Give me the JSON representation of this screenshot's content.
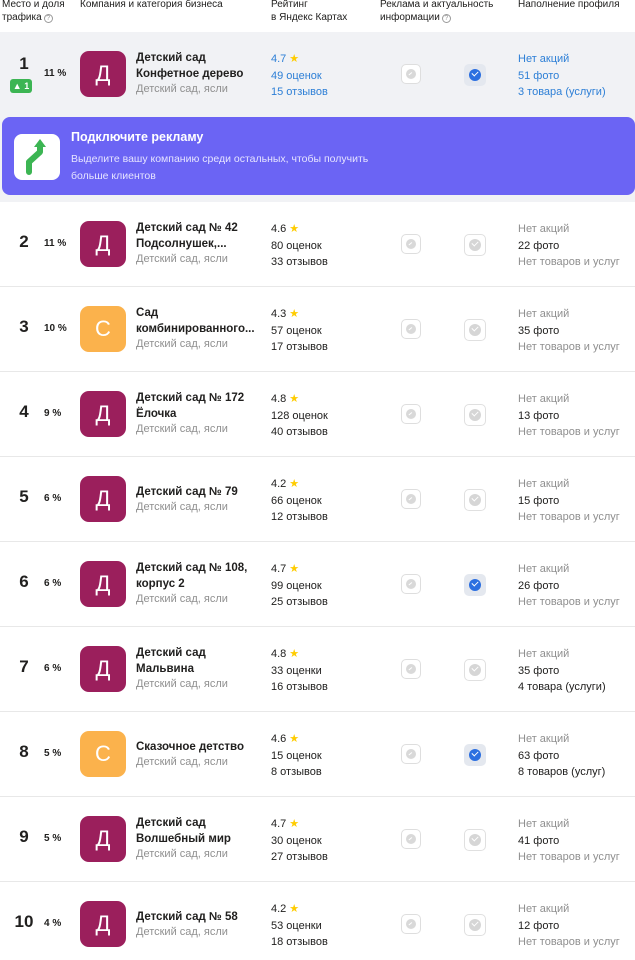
{
  "header": {
    "place_line1": "Место и доля",
    "place_line2": "трафика",
    "company": "Компания и категория бизнеса",
    "rating_line1": "Рейтинг",
    "rating_line2": "в Яндекс Картах",
    "ads_line1": "Реклама и актуальность",
    "ads_line2": "информации",
    "profile": "Наполнение профиля",
    "help_glyph": "?"
  },
  "promo": {
    "title": "Подключите рекламу",
    "text": "Выделите вашу компанию среди остальных, чтобы получить больше клиентов"
  },
  "star": "★",
  "rows": [
    {
      "place": "1",
      "delta": "▲ 1",
      "share": "11 %",
      "avatar": "Д",
      "avatar_style": "d",
      "name": "Детский сад Конфетное дерево",
      "category": "Детский сад, ясли",
      "rating": "4.7",
      "ratings_count": "49 оценок",
      "reviews": "15 отзывов",
      "promo_status": "Нет акций",
      "photos": "51 фото",
      "goods": "3 товара (услуги)",
      "verified": true
    },
    {
      "place": "2",
      "share": "11 %",
      "avatar": "Д",
      "avatar_style": "d",
      "name": "Детский сад № 42 Подсолнушек,...",
      "category": "Детский сад, ясли",
      "rating": "4.6",
      "ratings_count": "80 оценок",
      "reviews": "33 отзывов",
      "promo_status": "Нет акций",
      "photos": "22 фото",
      "goods": "Нет товаров и услуг",
      "verified": false
    },
    {
      "place": "3",
      "share": "10 %",
      "avatar": "С",
      "avatar_style": "c",
      "name": "Сад комбинированного...",
      "category": "Детский сад, ясли",
      "rating": "4.3",
      "ratings_count": "57 оценок",
      "reviews": "17 отзывов",
      "promo_status": "Нет акций",
      "photos": "35 фото",
      "goods": "Нет товаров и услуг",
      "verified": false
    },
    {
      "place": "4",
      "share": "9 %",
      "avatar": "Д",
      "avatar_style": "d",
      "name": "Детский сад № 172 Ёлочка",
      "category": "Детский сад, ясли",
      "rating": "4.8",
      "ratings_count": "128 оценок",
      "reviews": "40 отзывов",
      "promo_status": "Нет акций",
      "photos": "13 фото",
      "goods": "Нет товаров и услуг",
      "verified": false
    },
    {
      "place": "5",
      "share": "6 %",
      "avatar": "Д",
      "avatar_style": "d",
      "name": "Детский сад № 79",
      "category": "Детский сад, ясли",
      "rating": "4.2",
      "ratings_count": "66 оценок",
      "reviews": "12 отзывов",
      "promo_status": "Нет акций",
      "photos": "15 фото",
      "goods": "Нет товаров и услуг",
      "verified": false
    },
    {
      "place": "6",
      "share": "6 %",
      "avatar": "Д",
      "avatar_style": "d",
      "name": "Детский сад № 108, корпус 2",
      "category": "Детский сад, ясли",
      "rating": "4.7",
      "ratings_count": "99 оценок",
      "reviews": "25 отзывов",
      "promo_status": "Нет акций",
      "photos": "26 фото",
      "goods": "Нет товаров и услуг",
      "verified": true
    },
    {
      "place": "7",
      "share": "6 %",
      "avatar": "Д",
      "avatar_style": "d",
      "name": "Детский сад Мальвина",
      "category": "Детский сад, ясли",
      "rating": "4.8",
      "ratings_count": "33 оценки",
      "reviews": "16 отзывов",
      "promo_status": "Нет акций",
      "photos": "35 фото",
      "goods": "4 товара (услуги)",
      "verified": false
    },
    {
      "place": "8",
      "share": "5 %",
      "avatar": "С",
      "avatar_style": "c",
      "name": "Сказочное детство",
      "category": "Детский сад, ясли",
      "rating": "4.6",
      "ratings_count": "15 оценок",
      "reviews": "8 отзывов",
      "promo_status": "Нет акций",
      "photos": "63 фото",
      "goods": "8 товаров (услуг)",
      "verified": true
    },
    {
      "place": "9",
      "share": "5 %",
      "avatar": "Д",
      "avatar_style": "d",
      "name": "Детский сад Волшебный мир",
      "category": "Детский сад, ясли",
      "rating": "4.7",
      "ratings_count": "30 оценок",
      "reviews": "27 отзывов",
      "promo_status": "Нет акций",
      "photos": "41 фото",
      "goods": "Нет товаров и услуг",
      "verified": false
    },
    {
      "place": "10",
      "share": "4 %",
      "avatar": "Д",
      "avatar_style": "d",
      "name": "Детский сад № 58",
      "category": "Детский сад, ясли",
      "rating": "4.2",
      "ratings_count": "53 оценки",
      "reviews": "18 отзывов",
      "promo_status": "Нет акций",
      "photos": "12 фото",
      "goods": "Нет товаров и услуг",
      "verified": false
    }
  ],
  "colors": {
    "avatar_d": "#9b1f5c",
    "avatar_c": "#fbb24c",
    "promo_bg": "#6b64f4",
    "link": "#2d7fd6",
    "check_on": "#2c6fe0",
    "delta_up": "#3cb553"
  },
  "icons": {
    "ads": "ad-badge-icon",
    "verified": "verified-check-icon",
    "promo": "growth-arrow-icon"
  }
}
